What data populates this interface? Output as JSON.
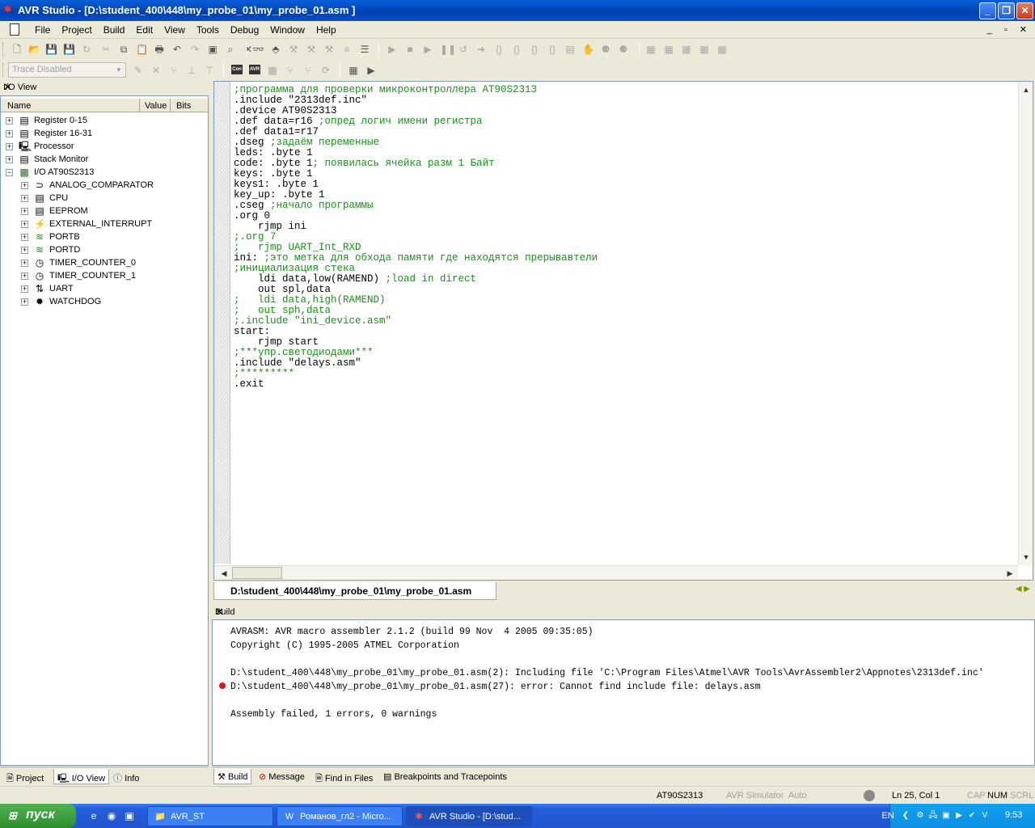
{
  "window": {
    "title": "AVR Studio - [D:\\student_400\\448\\my_probe_01\\my_probe_01.asm   ]",
    "controls": {
      "minimize": "_",
      "maximize": "❐",
      "close": "✕"
    }
  },
  "menu": {
    "items": [
      "File",
      "Project",
      "Build",
      "Edit",
      "View",
      "Tools",
      "Debug",
      "Window",
      "Help"
    ],
    "mdi_controls": "_ ▫ ✕"
  },
  "toolbar": {
    "trace_select": "Trace Disabled"
  },
  "io_view": {
    "title": "I/O View",
    "close": "✕",
    "columns": {
      "name": "Name",
      "value": "Value",
      "bits": "Bits"
    },
    "tree": [
      {
        "label": "Register 0-15",
        "level": 0,
        "expander": "+",
        "icon": "register-icon"
      },
      {
        "label": "Register 16-31",
        "level": 0,
        "expander": "+",
        "icon": "register-icon"
      },
      {
        "label": "Processor",
        "level": 0,
        "expander": "+",
        "icon": "processor-icon"
      },
      {
        "label": "Stack Monitor",
        "level": 0,
        "expander": "+",
        "icon": "stack-icon"
      },
      {
        "label": "I/O AT90S2313",
        "level": 0,
        "expander": "−",
        "icon": "chip-icon"
      },
      {
        "label": "ANALOG_COMPARATOR",
        "level": 1,
        "expander": "+",
        "icon": "comparator-icon"
      },
      {
        "label": "CPU",
        "level": 1,
        "expander": "+",
        "icon": "cpu-icon"
      },
      {
        "label": "EEPROM",
        "level": 1,
        "expander": "+",
        "icon": "eeprom-icon"
      },
      {
        "label": "EXTERNAL_INTERRUPT",
        "level": 1,
        "expander": "+",
        "icon": "interrupt-icon"
      },
      {
        "label": "PORTB",
        "level": 1,
        "expander": "+",
        "icon": "port-icon"
      },
      {
        "label": "PORTD",
        "level": 1,
        "expander": "+",
        "icon": "port-icon"
      },
      {
        "label": "TIMER_COUNTER_0",
        "level": 1,
        "expander": "+",
        "icon": "timer-icon"
      },
      {
        "label": "TIMER_COUNTER_1",
        "level": 1,
        "expander": "+",
        "icon": "timer-icon"
      },
      {
        "label": "UART",
        "level": 1,
        "expander": "+",
        "icon": "uart-icon"
      },
      {
        "label": "WATCHDOG",
        "level": 1,
        "expander": "+",
        "icon": "watchdog-icon"
      }
    ]
  },
  "left_tabs": [
    "Project",
    "I/O View",
    "Info"
  ],
  "editor": {
    "lines": [
      [
        [
          ";программа для проверки микроконтроллера AT90S2313",
          "cm"
        ]
      ],
      [
        [
          ".include \"2313def.inc\"",
          ""
        ]
      ],
      [
        [
          ".device AT90S2313",
          ""
        ]
      ],
      [
        [
          ".def data=r16 ",
          ""
        ],
        [
          ";опред логич имени регистра",
          "cm"
        ]
      ],
      [
        [
          ".def data1=r17",
          ""
        ]
      ],
      [
        [
          ".dseg ",
          ""
        ],
        [
          ";задаём переменные",
          "cm"
        ]
      ],
      [
        [
          "leds: .byte 1",
          ""
        ]
      ],
      [
        [
          "code: .byte 1",
          ""
        ],
        [
          "; появилась ячейка разм 1 Байт",
          "cm"
        ]
      ],
      [
        [
          "keys: .byte 1",
          ""
        ]
      ],
      [
        [
          "keys1: .byte 1",
          ""
        ]
      ],
      [
        [
          "key_up: .byte 1",
          ""
        ]
      ],
      [
        [
          ".cseg ",
          ""
        ],
        [
          ";начало программы",
          "cm"
        ]
      ],
      [
        [
          ".org 0",
          ""
        ]
      ],
      [
        [
          "    rjmp ini",
          ""
        ]
      ],
      [
        [
          ";.org 7",
          "cm"
        ]
      ],
      [
        [
          ";   rjmp UART_Int_RXD",
          "cm"
        ]
      ],
      [
        [
          "ini: ",
          ""
        ],
        [
          ";это метка для обхода памяти где находятся прерывавтели",
          "cm"
        ]
      ],
      [
        [
          ";инициализация стека",
          "cm"
        ]
      ],
      [
        [
          "    ldi data,low(RAMEND) ",
          ""
        ],
        [
          ";load in direct",
          "cm"
        ]
      ],
      [
        [
          "    out spl,data",
          ""
        ]
      ],
      [
        [
          ";   ldi data,high(RAMEND)",
          "cm"
        ]
      ],
      [
        [
          ";   out sph,data",
          "cm"
        ]
      ],
      [
        [
          ";.include \"ini_device.asm\"",
          "cm"
        ]
      ],
      [
        [
          "start:",
          ""
        ]
      ],
      [
        [
          "    rjmp start",
          ""
        ]
      ],
      [
        [
          ";***упр.светодиодами***",
          "cm"
        ]
      ],
      [
        [
          ".include \"delays.asm\"",
          ""
        ]
      ],
      [
        [
          ";*********",
          "cm"
        ]
      ],
      [
        [
          ".exit",
          ""
        ]
      ]
    ]
  },
  "doc_tab": "D:\\student_400\\448\\my_probe_01\\my_probe_01.asm",
  "build": {
    "title": "Build",
    "close": "✕",
    "lines": [
      "AVRASM: AVR macro assembler 2.1.2 (build 99 Nov  4 2005 09:35:05)",
      "Copyright (C) 1995-2005 ATMEL Corporation",
      "",
      "D:\\student_400\\448\\my_probe_01\\my_probe_01.asm(2): Including file 'C:\\Program Files\\Atmel\\AVR Tools\\AvrAssembler2\\Appnotes\\2313def.inc'",
      "D:\\student_400\\448\\my_probe_01\\my_probe_01.asm(27): error: Cannot find include file: delays.asm",
      "",
      "Assembly failed, 1 errors, 0 warnings"
    ]
  },
  "build_tabs": [
    "Build",
    "Message",
    "Find in Files",
    "Breakpoints and Tracepoints"
  ],
  "status": {
    "device": "AT90S2313",
    "simulator": "AVR Simulator",
    "mode": "Auto",
    "position": "Ln 25, Col 1",
    "cap": "CAP",
    "num": "NUM",
    "scrl": "SCRL"
  },
  "taskbar": {
    "start": "пуск",
    "tasks": [
      "AVR_ST",
      "Романов_гл2 - Micro...",
      "AVR Studio - [D:\\stud..."
    ],
    "lang": "EN",
    "clock": "9:53"
  }
}
